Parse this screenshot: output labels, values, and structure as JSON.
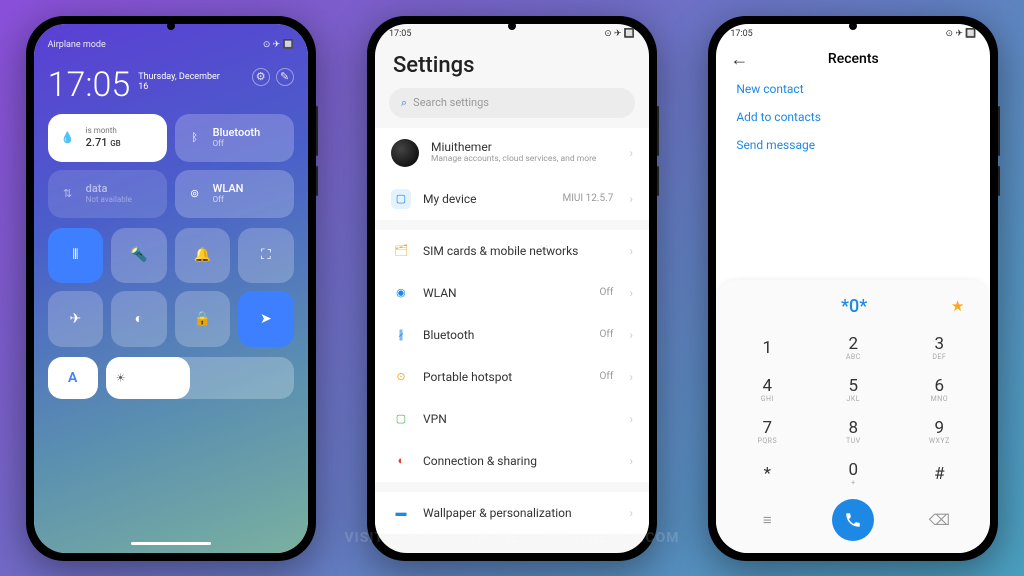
{
  "watermark": "VISIT FOR MORE THEMES - MIUITHEMER.COM",
  "statusbar": {
    "time": "17:05",
    "airplane": "Airplane mode"
  },
  "control_center": {
    "clock": "17:05",
    "date_line1": "Thursday, December",
    "date_line2": "16",
    "data_tile": {
      "sub": "is month",
      "value": "2.71",
      "unit": "GB"
    },
    "bluetooth_tile": {
      "label": "Bluetooth",
      "status": "Off"
    },
    "mobile_tile": {
      "label": "data",
      "status": "Not available"
    },
    "wlan_tile": {
      "label": "WLAN",
      "status": "Off"
    },
    "auto_label": "A"
  },
  "settings": {
    "title": "Settings",
    "search_placeholder": "Search settings",
    "account": {
      "name": "Miuithemer",
      "sub": "Manage accounts, cloud services, and more"
    },
    "my_device": {
      "label": "My device",
      "value": "MIUI 12.5.7"
    },
    "rows": [
      {
        "icon": "🗂",
        "color": "#f5a623",
        "label": "SIM cards & mobile networks",
        "value": ""
      },
      {
        "icon": "◉",
        "color": "#1e88e5",
        "label": "WLAN",
        "value": "Off"
      },
      {
        "icon": "∦",
        "color": "#1e88e5",
        "label": "Bluetooth",
        "value": "Off"
      },
      {
        "icon": "⊙",
        "color": "#f5a623",
        "label": "Portable hotspot",
        "value": "Off"
      },
      {
        "icon": "▢",
        "color": "#4caf50",
        "label": "VPN",
        "value": ""
      },
      {
        "icon": "◐",
        "color": "#e53935",
        "label": "Connection & sharing",
        "value": ""
      }
    ],
    "wallpaper": {
      "icon": "▬",
      "label": "Wallpaper & personalization"
    }
  },
  "dialer": {
    "title": "Recents",
    "actions": [
      "New contact",
      "Add to contacts",
      "Send message"
    ],
    "display": "*0*",
    "keys": [
      {
        "n": "1",
        "l": ""
      },
      {
        "n": "2",
        "l": "ABC"
      },
      {
        "n": "3",
        "l": "DEF"
      },
      {
        "n": "4",
        "l": "GHI"
      },
      {
        "n": "5",
        "l": "JKL"
      },
      {
        "n": "6",
        "l": "MNO"
      },
      {
        "n": "7",
        "l": "PQRS"
      },
      {
        "n": "8",
        "l": "TUV"
      },
      {
        "n": "9",
        "l": "WXYZ"
      },
      {
        "n": "*",
        "l": ""
      },
      {
        "n": "0",
        "l": "+"
      },
      {
        "n": "#",
        "l": ""
      }
    ]
  }
}
